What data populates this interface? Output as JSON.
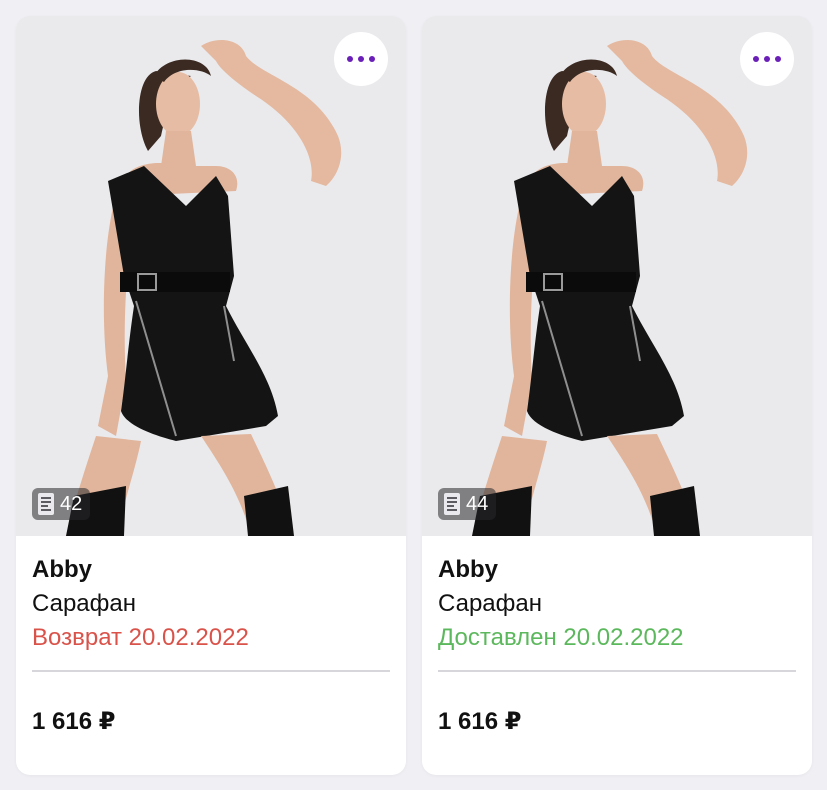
{
  "colors": {
    "accent": "#6a1fb8",
    "status_return": "#d9534a",
    "status_delivered": "#5cb85c"
  },
  "cards": [
    {
      "reviews_count": "42",
      "brand": "Abby",
      "name": "Сарафан",
      "status": "Возврат 20.02.2022",
      "status_color": "#d9534a",
      "price": "1 616 ₽"
    },
    {
      "reviews_count": "44",
      "brand": "Abby",
      "name": "Сарафан",
      "status": "Доставлен 20.02.2022",
      "status_color": "#5cb85c",
      "price": "1 616 ₽"
    }
  ]
}
